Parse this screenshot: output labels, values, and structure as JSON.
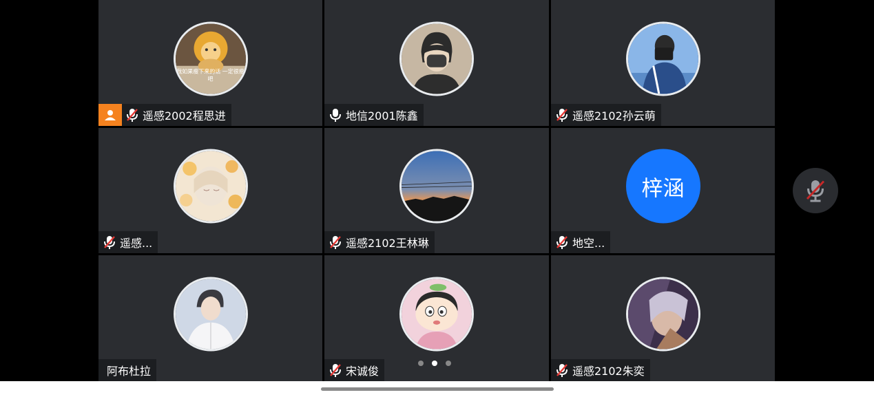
{
  "participants": [
    {
      "name": "遥感2002程思进",
      "muted": true,
      "host": true,
      "avatar": "photo-plush-lion",
      "avatar_caption": "我如果瘦下来的话 一定很瘦吧"
    },
    {
      "name": "地信2001陈鑫",
      "muted": false,
      "host": false,
      "avatar": "photo-cartoon-boy-mask"
    },
    {
      "name": "遥感2102孙云萌",
      "muted": true,
      "host": false,
      "avatar": "photo-person-camera"
    },
    {
      "name": "遥感...",
      "muted": true,
      "host": false,
      "avatar": "photo-anime-flowers"
    },
    {
      "name": "遥感2102王林琳",
      "muted": true,
      "host": false,
      "avatar": "photo-sunset-sky"
    },
    {
      "name": "地空...",
      "muted": true,
      "host": false,
      "avatar_text": "梓涵"
    },
    {
      "name": "阿布杜拉",
      "muted": false,
      "host": false,
      "avatar": "photo-young-man"
    },
    {
      "name": "宋诚俊",
      "muted": true,
      "host": false,
      "avatar": "photo-cartoon-shinchan"
    },
    {
      "name": "遥感2102朱奕",
      "muted": true,
      "host": false,
      "avatar": "photo-anime-art"
    }
  ],
  "pagination": {
    "pages": 3,
    "current": 2
  },
  "controls": {
    "self_mic_icon": "mic-muted-icon"
  },
  "colors": {
    "tile_bg": "#2b2d31",
    "host_badge": "#f5821f",
    "text_avatar_bg": "#1677ff",
    "muted_red": "#e53935"
  }
}
